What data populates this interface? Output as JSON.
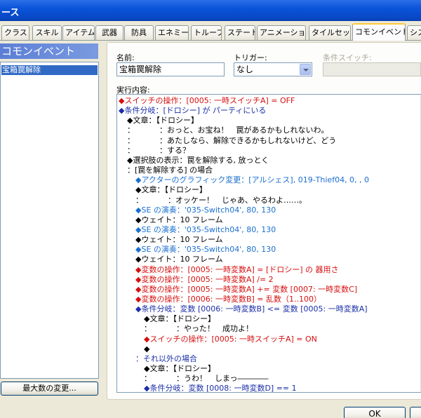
{
  "window": {
    "title": "ース"
  },
  "tabs": [
    "クラス",
    "スキル",
    "アイテム",
    "武器",
    "防具",
    "エネミー",
    "トループ",
    "ステート",
    "アニメーション",
    "タイルセット",
    "コモンイベント",
    "シス"
  ],
  "active_tab_index": 10,
  "left_panel": {
    "header": "コモンイベント",
    "items": [
      "宝箱罠解除"
    ],
    "max_button": "最大数の変更..."
  },
  "form": {
    "name_label": "名前:",
    "name_value": "宝箱罠解除",
    "trigger_label": "トリガー:",
    "trigger_value": "なし",
    "switch_label": "条件スイッチ:",
    "contents_label": "実行内容:"
  },
  "commands": [
    {
      "text": "◆スイッチの操作：[0005: 一時スイッチA] = OFF",
      "color": "red",
      "indent": 0
    },
    {
      "text": "◆条件分岐：[ドロシー] が パーティにいる",
      "color": "blue",
      "indent": 0
    },
    {
      "text": "◆文章：【ドロシー】",
      "color": "black",
      "indent": 1
    },
    {
      "text": "：          ：おっと、お宝ね！　罠があるかもしれないわ。",
      "color": "black",
      "indent": 1
    },
    {
      "text": "：          ：あたしなら、解除できるかもしれないけど、どう",
      "color": "black",
      "indent": 1
    },
    {
      "text": "：          ：する？",
      "color": "black",
      "indent": 1
    },
    {
      "text": "◆選択肢の表示：罠を解除する, 放っとく",
      "color": "black",
      "indent": 1
    },
    {
      "text": "：[罠を解除する] の場合",
      "color": "black",
      "indent": 1
    },
    {
      "text": "◆アクターのグラフィック変更：[アルシェス], 019-Thief04, 0, , 0",
      "color": "lblue",
      "indent": 2
    },
    {
      "text": "◆文章：【ドロシー】",
      "color": "black",
      "indent": 2
    },
    {
      "text": "：          ：オッケー！　じゃあ、やるわよ……。",
      "color": "black",
      "indent": 2
    },
    {
      "text": "◆SE の演奏：'035-Switch04', 80, 130",
      "color": "lblue",
      "indent": 2
    },
    {
      "text": "◆ウェイト：10 フレーム",
      "color": "black",
      "indent": 2
    },
    {
      "text": "◆SE の演奏：'035-Switch04', 80, 130",
      "color": "lblue",
      "indent": 2
    },
    {
      "text": "◆ウェイト：10 フレーム",
      "color": "black",
      "indent": 2
    },
    {
      "text": "◆SE の演奏：'035-Switch04', 80, 130",
      "color": "lblue",
      "indent": 2
    },
    {
      "text": "◆ウェイト：10 フレーム",
      "color": "black",
      "indent": 2
    },
    {
      "text": "◆変数の操作：[0005: 一時変数A] = [ドロシー] の 器用さ",
      "color": "red",
      "indent": 2
    },
    {
      "text": "◆変数の操作：[0005: 一時変数A] /= 2",
      "color": "red",
      "indent": 2
    },
    {
      "text": "◆変数の操作：[0005: 一時変数A] += 変数 [0007: 一時変数C]",
      "color": "red",
      "indent": 2
    },
    {
      "text": "◆変数の操作：[0006: 一時変数B] = 乱数（1..100）",
      "color": "red",
      "indent": 2
    },
    {
      "text": "◆条件分岐：変数 [0006: 一時変数B] <= 変数 [0005: 一時変数A]",
      "color": "blue",
      "indent": 2
    },
    {
      "text": "◆文章：【ドロシー】",
      "color": "black",
      "indent": 3
    },
    {
      "text": "：          ：やった！　成功よ！",
      "color": "black",
      "indent": 3
    },
    {
      "text": "◆スイッチの操作：[0005: 一時スイッチA] = ON",
      "color": "red",
      "indent": 3
    },
    {
      "text": "◆",
      "color": "black",
      "indent": 3
    },
    {
      "text": "：それ以外の場合",
      "color": "blue",
      "indent": 2
    },
    {
      "text": "◆文章：【ドロシー】",
      "color": "black",
      "indent": 3
    },
    {
      "text": "：          ：うわ！　しまっ――――",
      "color": "black",
      "indent": 3
    },
    {
      "text": "◆条件分岐：変数 [0008: 一時変数D] == 1",
      "color": "blue",
      "indent": 3
    }
  ],
  "buttons": {
    "ok": "OK"
  },
  "colors": {
    "red": "#d61010",
    "blue": "#1a2fa8",
    "lblue": "#1a6fd0",
    "black": "#000000"
  }
}
